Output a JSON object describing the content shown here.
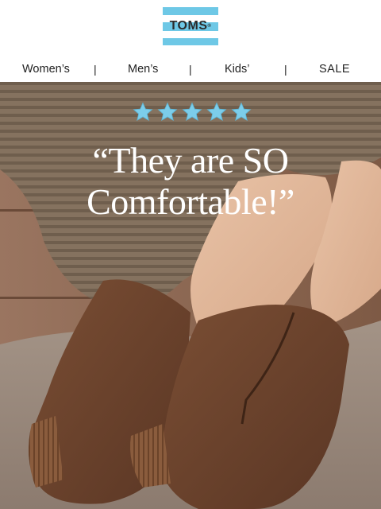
{
  "brand": {
    "logo_text": "TOMS",
    "trademark": "®",
    "logo_color": "#6ec8e6"
  },
  "nav": {
    "items": [
      "Women’s",
      "Men’s",
      "Kids’",
      "SALE"
    ],
    "separator": "|"
  },
  "hero": {
    "rating_stars": 5,
    "star_color": "#7ccdea",
    "quote_line1": "“They are SO",
    "quote_line2": "Comfortable!”"
  }
}
